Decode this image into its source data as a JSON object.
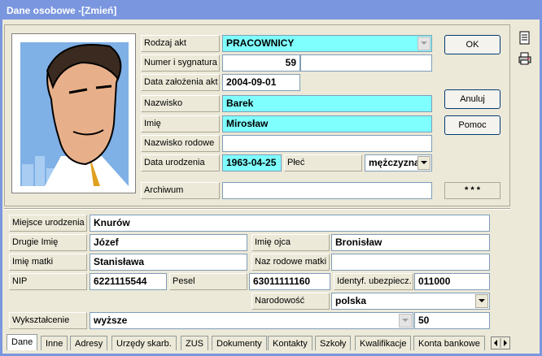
{
  "window": {
    "title": "Dane osobowe -[Zmień]"
  },
  "top": {
    "rodzaj_akt_label": "Rodzaj akt",
    "rodzaj_akt_value": "PRACOWNICY",
    "numer_label": "Numer i sygnatura",
    "numer_value": "59",
    "sygnatura_value": "",
    "data_zalozenia_label": "Data założenia akt",
    "data_zalozenia_value": "2004-09-01",
    "nazwisko_label": "Nazwisko",
    "nazwisko_value": "Barek",
    "imie_label": "Imię",
    "imie_value": "Mirosław",
    "nazwisko_rodowe_label": "Nazwisko rodowe",
    "nazwisko_rodowe_value": "",
    "data_urodzenia_label": "Data urodzenia",
    "data_urodzenia_value": "1963-04-25",
    "plec_label": "Płeć",
    "plec_value": "mężczyzna",
    "archiwum_label": "Archiwum",
    "archiwum_value": ""
  },
  "buttons": {
    "ok": "OK",
    "anuluj": "Anuluj",
    "pomoc": "Pomoc",
    "more": "* * *"
  },
  "bottom": {
    "miejsce_urodzenia_label": "Miejsce urodzenia",
    "miejsce_urodzenia_value": "Knurów",
    "drugie_imie_label": "Drugie Imię",
    "drugie_imie_value": "Józef",
    "imie_ojca_label": "Imię ojca",
    "imie_ojca_value": "Bronisław",
    "imie_matki_label": "Imię matki",
    "imie_matki_value": "Stanisława",
    "nazw_rodowe_matki_label": "Naz rodowe matki",
    "nazw_rodowe_matki_value": "",
    "nip_label": "NIP",
    "nip_value": "6221115544",
    "pesel_label": "Pesel",
    "pesel_value": "63011111160",
    "identyf_label": "Identyf. ubezpiecz.",
    "identyf_value": "011000",
    "narodowosc_label": "Narodowość",
    "narodowosc_value": "polska",
    "wyksztalcenie_label": "Wykształcenie",
    "wyksztalcenie_value": "wyższe",
    "wyksztalcenie_code": "50"
  },
  "tabs": [
    "Dane",
    "Inne",
    "Adresy",
    "Urzędy skarb.",
    "ZUS",
    "Dokumenty",
    "Kontakty",
    "Szkoły",
    "Kwalifikacje",
    "Konta bankowe"
  ],
  "colors": {
    "highlight": "#80FFFF",
    "titlebar": "#7A96DF",
    "face": "#ECE9D8"
  }
}
